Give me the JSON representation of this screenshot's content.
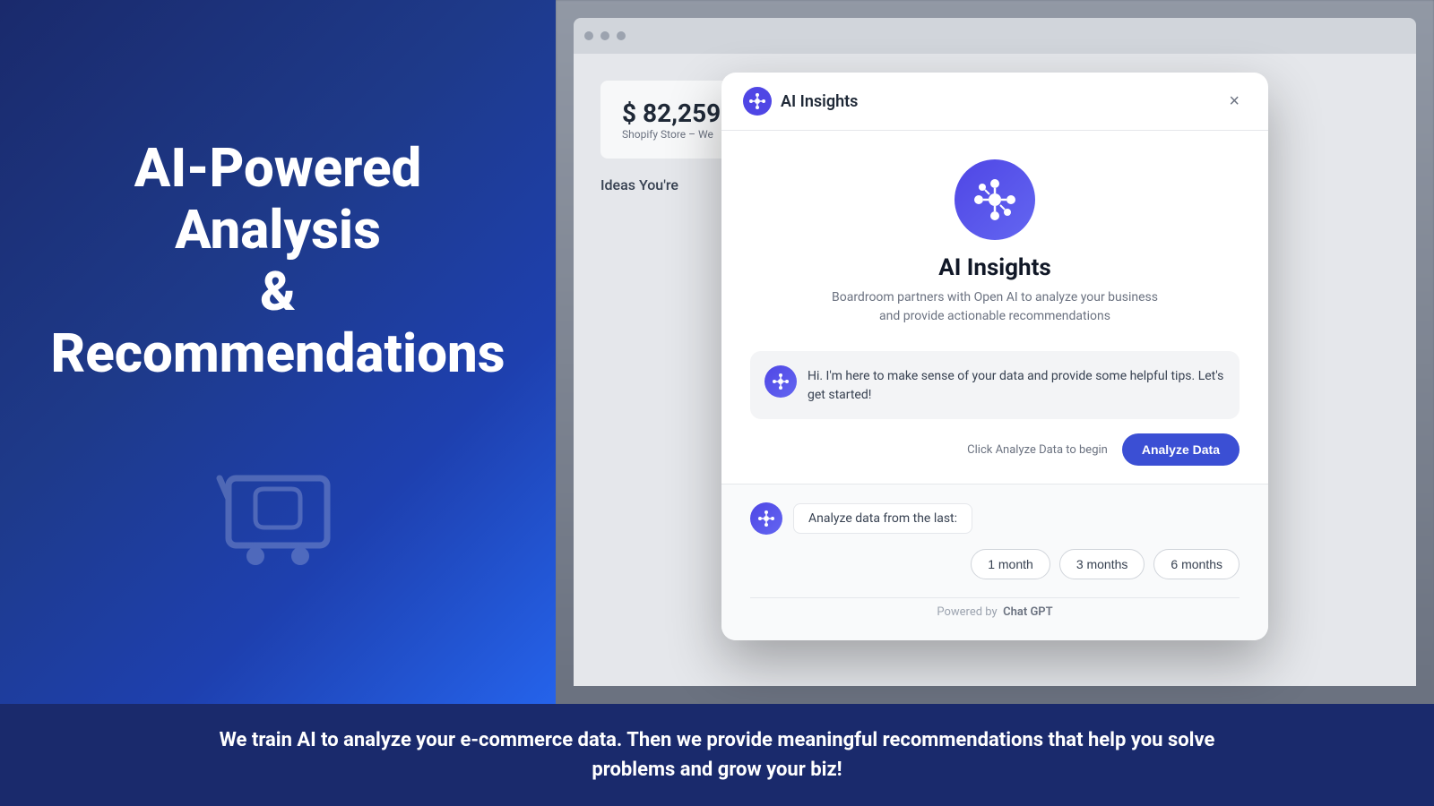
{
  "left_panel": {
    "title_line1": "AI-Powered",
    "title_line2": "Analysis",
    "title_line3": "&",
    "title_line4": "Recommendations"
  },
  "modal": {
    "header": {
      "title": "AI Insights",
      "close_label": "×"
    },
    "center": {
      "title": "AI Insights",
      "subtitle": "Boardroom partners with Open AI to analyze your business and provide actionable recommendations"
    },
    "chat": {
      "message": "Hi. I'm here to make sense of your data and provide some helpful tips. Let's get started!"
    },
    "analyze": {
      "hint": "Click Analyze Data to begin",
      "button_label": "Analyze Data"
    },
    "data_section": {
      "prompt_label": "Analyze data from the last:"
    },
    "time_options": [
      {
        "label": "1 month"
      },
      {
        "label": "3 months"
      },
      {
        "label": "6 months"
      }
    ],
    "footer": {
      "powered_text": "Powered by",
      "brand": "Chat GPT"
    }
  },
  "browser_bg": {
    "revenue_amount": "$ 82,259",
    "revenue_label": "Shopify Store – We",
    "ideas_text": "Ideas You're"
  },
  "bottom_banner": {
    "text": "We train AI to analyze your e-commerce data. Then we provide meaningful recommendations that help you solve problems and grow your biz!"
  }
}
